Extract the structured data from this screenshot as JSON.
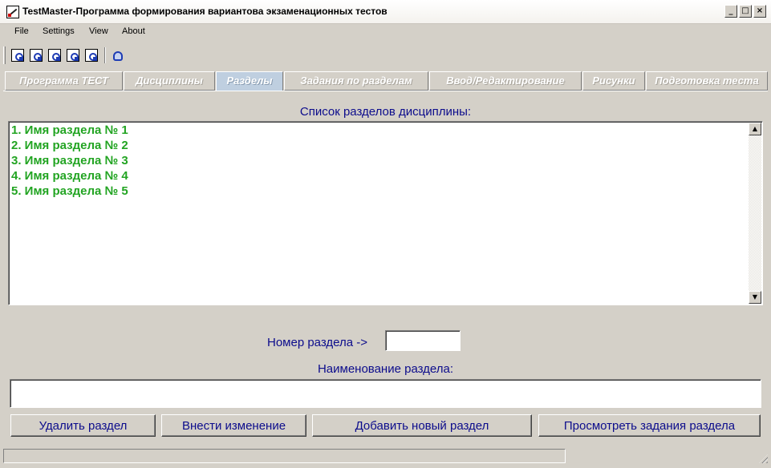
{
  "window": {
    "title": "TestMaster-Программа формирования вариантова экзаменационных тестов",
    "minimize": "_",
    "maximize": "□",
    "close": "×"
  },
  "menu": {
    "file": "File",
    "settings": "Settings",
    "view": "View",
    "about": "About"
  },
  "toolbar": {
    "icons": [
      "document-icon",
      "document-icon",
      "document-icon",
      "document-icon",
      "document-icon",
      "lock-icon"
    ]
  },
  "tabs": [
    {
      "label": "Программа ТЕСТ"
    },
    {
      "label": "Дисциплины"
    },
    {
      "label": "Разделы"
    },
    {
      "label": "Задания по разделам"
    },
    {
      "label": "Ввод/Редактирование"
    },
    {
      "label": "Рисунки"
    },
    {
      "label": "Подготовка теста"
    }
  ],
  "sections": {
    "caption": "Список разделов дисциплины:",
    "items": [
      "1. Имя раздела № 1",
      "2. Имя раздела № 2",
      "3. Имя раздела № 3",
      "4. Имя раздела № 4",
      "5. Имя раздела № 5"
    ],
    "scroll_up": "▲",
    "scroll_down": "▼"
  },
  "form": {
    "number_label": "Номер раздела ->",
    "number_value": "",
    "name_label": "Наименование раздела:",
    "name_value": ""
  },
  "buttons": {
    "delete": "Удалить раздел",
    "apply": "Внести изменение",
    "add": "Добавить новый раздел",
    "view_tasks": "Просмотреть задания раздела"
  },
  "colors": {
    "label_blue": "#0c0c8c",
    "list_green": "#22a422",
    "active_tab": "#bfcfe0",
    "background": "#d4d0c8"
  }
}
